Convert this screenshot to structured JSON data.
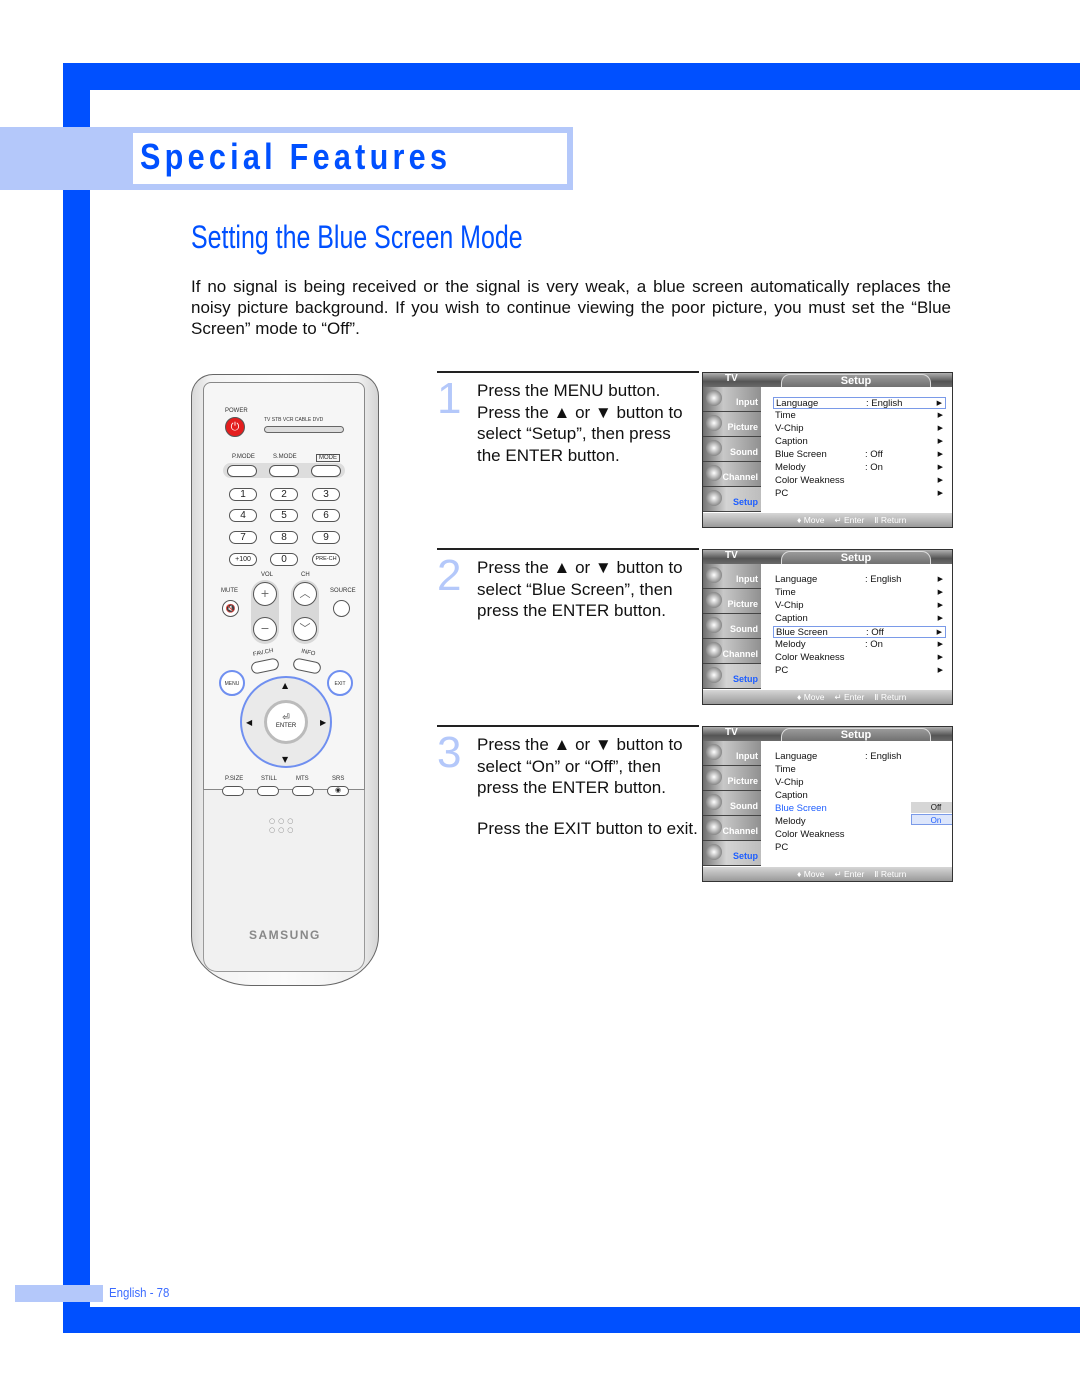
{
  "header": {
    "section_title": "Special Features",
    "page_heading": "Setting the Blue Screen Mode"
  },
  "intro": "If no signal is being received or the signal is very weak, a blue screen automatically replaces the noisy picture background. If you wish to continue viewing the poor picture, you must set the “Blue Screen” mode to “Off”.",
  "colors": {
    "brand_blue": "#0050ff",
    "light_blue": "#b4c8fa",
    "power_red": "#e41e1e",
    "osd_highlight": "#1e5eff"
  },
  "remote": {
    "power_label": "POWER",
    "source_labels": "TV  STB  VCR  CABLE  DVD",
    "mode_labels": [
      "P.MODE",
      "S.MODE",
      "MODE"
    ],
    "number_keys": [
      "1",
      "2",
      "3",
      "4",
      "5",
      "6",
      "7",
      "8",
      "9",
      "+100",
      "0",
      "PRE-CH"
    ],
    "vol_label": "VOL",
    "ch_label": "CH",
    "mute_label": "MUTE",
    "source_label": "SOURCE",
    "fav_label": "FAV.CH",
    "info_label": "INFO",
    "menu_label": "MENU",
    "exit_label": "EXIT",
    "enter_label": "ENTER",
    "bottom_labels": [
      "P.SIZE",
      "STILL",
      "MTS",
      "SRS"
    ],
    "brand": "SAMSUNG",
    "icons": {
      "power": "power-icon",
      "mute": "mute-icon",
      "vol_up": "plus-icon",
      "vol_down": "minus-icon",
      "ch_up": "chevron-up-icon",
      "ch_down": "chevron-down-icon",
      "enter": "enter-icon",
      "srs": "srs-icon"
    }
  },
  "steps": [
    {
      "number": "1",
      "lines": [
        "Press the MENU button.",
        "Press the ▲ or ▼ button to",
        "select “Setup”, then press",
        "the ENTER button."
      ]
    },
    {
      "number": "2",
      "lines": [
        "Press the ▲ or ▼ button to",
        "select “Blue Screen”, then",
        "press the ENTER button."
      ]
    },
    {
      "number": "3",
      "lines": [
        "Press the ▲ or ▼ button to",
        "select “On” or “Off”, then",
        "press the ENTER button."
      ],
      "extra": "Press the EXIT button to exit."
    }
  ],
  "osd": {
    "tv_label": "TV",
    "menu_title": "Setup",
    "sidebar": [
      "Input",
      "Picture",
      "Sound",
      "Channel",
      "Setup"
    ],
    "active_sidebar": "Setup",
    "items": [
      {
        "label": "Language",
        "value": ": English"
      },
      {
        "label": "Time",
        "value": ""
      },
      {
        "label": "V-Chip",
        "value": ""
      },
      {
        "label": "Caption",
        "value": ""
      },
      {
        "label": "Blue Screen",
        "value": ": Off"
      },
      {
        "label": "Melody",
        "value": ": On"
      },
      {
        "label": "Color Weakness",
        "value": ""
      },
      {
        "label": "PC",
        "value": ""
      }
    ],
    "footer": {
      "move": "♦ Move",
      "enter": "↵ Enter",
      "return": "Ⅱ Return"
    },
    "screens": [
      {
        "selected_item": "Language"
      },
      {
        "selected_item": "Blue Screen"
      },
      {
        "highlighted_item": "Blue Screen",
        "popup_options": [
          "Off",
          "On"
        ],
        "popup_selected": "On"
      }
    ]
  },
  "footer": {
    "page_label": "English - 78"
  }
}
